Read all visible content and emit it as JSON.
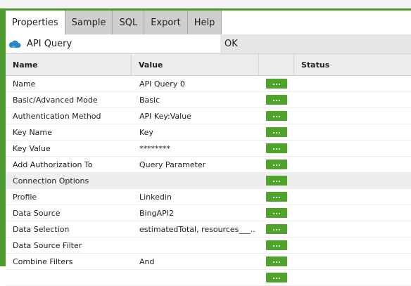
{
  "tabs": [
    {
      "label": "Properties"
    },
    {
      "label": "Sample"
    },
    {
      "label": "SQL"
    },
    {
      "label": "Export"
    },
    {
      "label": "Help"
    }
  ],
  "title": {
    "text": "API Query",
    "icon": "cloud-icon",
    "ok_label": "OK"
  },
  "grid": {
    "headers": {
      "name": "Name",
      "value": "Value",
      "button": "",
      "status": "Status"
    },
    "button_label": "...",
    "rows": [
      {
        "name": "Name",
        "value": "API Query 0",
        "section": false
      },
      {
        "name": "Basic/Advanced Mode",
        "value": "Basic",
        "section": false
      },
      {
        "name": "Authentication Method",
        "value": "API Key:Value",
        "section": false
      },
      {
        "name": "Key Name",
        "value": "Key",
        "section": false
      },
      {
        "name": "Key Value",
        "value": "********",
        "section": false
      },
      {
        "name": "Add Authorization To",
        "value": "Query Parameter",
        "section": false
      },
      {
        "name": "Connection Options",
        "value": "",
        "section": true
      },
      {
        "name": "Profile",
        "value": "Linkedin",
        "section": false
      },
      {
        "name": "Data Source",
        "value": "BingAPI2",
        "section": false
      },
      {
        "name": "Data Selection",
        "value": "estimatedTotal, resources___....",
        "section": false
      },
      {
        "name": "Data Source Filter",
        "value": "",
        "section": false
      },
      {
        "name": "Combine Filters",
        "value": "And",
        "section": false
      },
      {
        "name": "",
        "value": "",
        "section": false
      }
    ]
  },
  "colors": {
    "accent": "#4b9b2e",
    "button": "#4fa22a"
  }
}
